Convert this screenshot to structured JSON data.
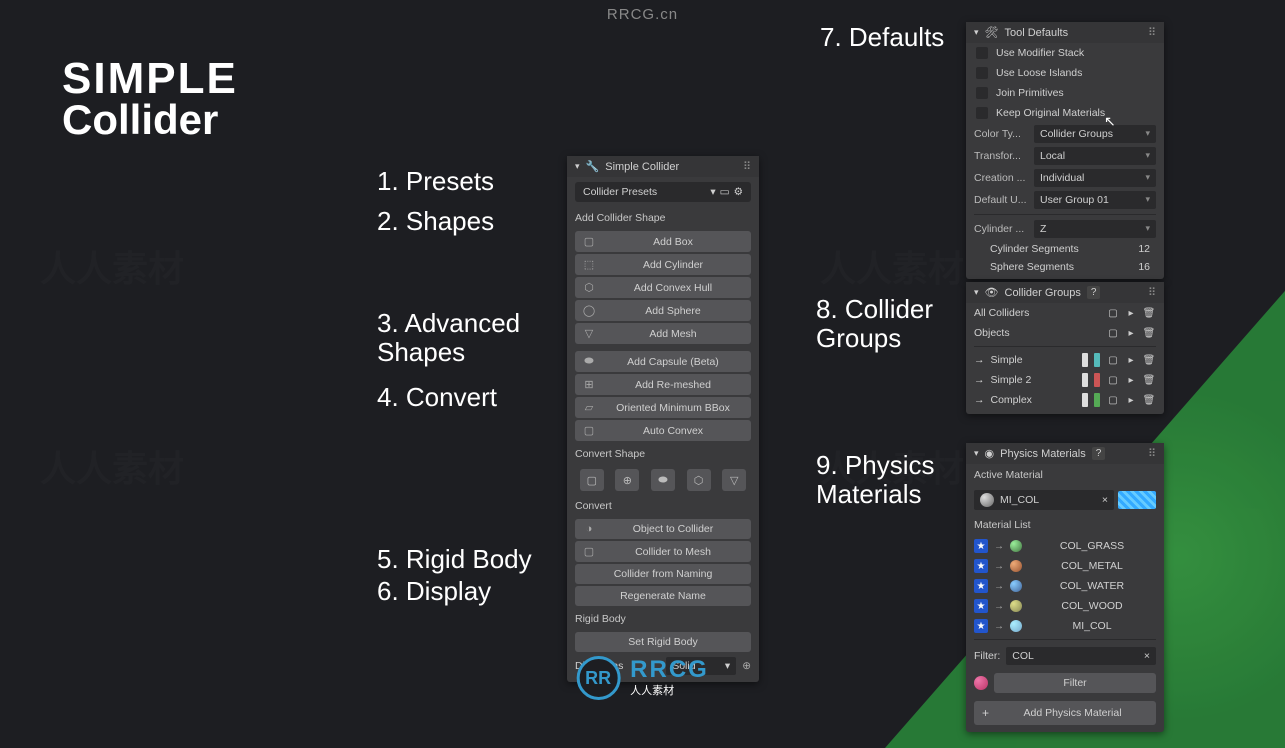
{
  "watermark_top": "RRCG.cn",
  "logo": {
    "line1": "SIMPLE",
    "line2": "Collider"
  },
  "labels": {
    "l1": "1. Presets",
    "l2": "2. Shapes",
    "l3a": "3. Advanced",
    "l3b": "Shapes",
    "l4": "4. Convert",
    "l5": "5. Rigid Body",
    "l6": "6. Display",
    "l7": "7. Defaults",
    "l8a": "8. Collider",
    "l8b": "Groups",
    "l9a": "9. Physics",
    "l9b": "Materials"
  },
  "main_panel": {
    "title": "Simple Collider",
    "presets_dd": "Collider Presets",
    "add_shape_label": "Add Collider Shape",
    "shapes": [
      "Add Box",
      "Add Cylinder",
      "Add Convex Hull",
      "Add Sphere",
      "Add Mesh"
    ],
    "adv_shapes": [
      "Add Capsule (Beta)",
      "Add Re-meshed",
      "Oriented Minimum BBox",
      "Auto Convex"
    ],
    "convert_shape_label": "Convert Shape",
    "convert_label": "Convert",
    "convert_btns": [
      "Object to Collider",
      "Collider to Mesh",
      "Collider from Naming",
      "Regenerate Name"
    ],
    "rigid_body_label": "Rigid Body",
    "rigid_body_btn": "Set Rigid Body",
    "display_as": "Display as",
    "display_val": "Solid"
  },
  "defaults_panel": {
    "title": "Tool Defaults",
    "checks": [
      "Use Modifier Stack",
      "Use Loose Islands",
      "Join Primitives",
      "Keep Original Materials"
    ],
    "props": [
      {
        "label": "Color Ty...",
        "value": "Collider Groups"
      },
      {
        "label": "Transfor...",
        "value": "Local"
      },
      {
        "label": "Creation ...",
        "value": "Individual"
      },
      {
        "label": "Default U...",
        "value": "User Group 01"
      }
    ],
    "cylinder_axis_label": "Cylinder ...",
    "cylinder_axis_val": "Z",
    "cyl_seg_label": "Cylinder Segments",
    "cyl_seg_val": "12",
    "sph_seg_label": "Sphere Segments",
    "sph_seg_val": "16"
  },
  "groups_panel": {
    "title": "Collider Groups",
    "all": "All Colliders",
    "objects": "Objects",
    "groups": [
      "Simple",
      "Simple 2",
      "Complex"
    ]
  },
  "physics_panel": {
    "title": "Physics Materials",
    "active_label": "Active Material",
    "active_name": "MI_COL",
    "list_label": "Material List",
    "materials": [
      "COL_GRASS",
      "COL_METAL",
      "COL_WATER",
      "COL_WOOD",
      "MI_COL"
    ],
    "filter_label": "Filter:",
    "filter_val": "COL",
    "filter_btn": "Filter",
    "add_btn": "Add Physics Material"
  },
  "footer": {
    "big": "RRCG",
    "small": "人人素材"
  }
}
